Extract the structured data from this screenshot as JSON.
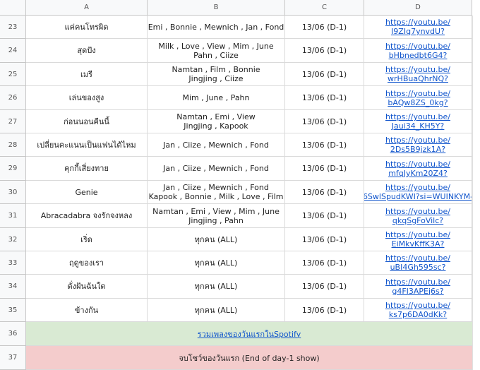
{
  "columns": [
    "A",
    "B",
    "C",
    "D"
  ],
  "rows": [
    {
      "num": "23",
      "song": "แค่คนโทรผิด",
      "members": "Emi , Bonnie , Mewnich , Jan , Fond",
      "date": "13/06 (D-1)",
      "link1": "https://youtu.be/",
      "link2": "I9ZIq7ynvdU?"
    },
    {
      "num": "24",
      "song": "สุดปัง",
      "members": "Milk , Love , View , Mim , June\nPahn , Ciize",
      "date": "13/06 (D-1)",
      "link1": "https://youtu.be/",
      "link2": "bHbnedbt6G4?"
    },
    {
      "num": "25",
      "song": "เมรี",
      "members": "Namtan , Film , Bonnie\nJingjing , Ciize",
      "date": "13/06 (D-1)",
      "link1": "https://youtu.be/",
      "link2": "wrHBuaQhrNQ?"
    },
    {
      "num": "26",
      "song": "เล่นของสูง",
      "members": "Mim , June , Pahn",
      "date": "13/06 (D-1)",
      "link1": "https://youtu.be/",
      "link2": "bAQw8ZS_0kg?"
    },
    {
      "num": "27",
      "song": "ก่อนนอนคืนนี้",
      "members": "Namtan , Emi , View\nJingjing , Kapook",
      "date": "13/06 (D-1)",
      "link1": "https://youtu.be/",
      "link2": "Jaui34_KH5Y?"
    },
    {
      "num": "28",
      "song": "เปลี่ยนคะแนนเป็นแฟนได้ไหม",
      "members": "Jan , Ciize , Mewnich , Fond",
      "date": "13/06 (D-1)",
      "link1": "https://youtu.be/",
      "link2": "2Ds5B9jzk1A?"
    },
    {
      "num": "29",
      "song": "คุกกี้เสี่ยงทาย",
      "members": "Jan , Ciize , Mewnich , Fond",
      "date": "13/06 (D-1)",
      "link1": "https://youtu.be/",
      "link2": "mfqJyKm20Z4?"
    },
    {
      "num": "30",
      "song": "Genie",
      "members": "Jan , Ciize , Mewnich , Fond\nKapook , Bonnie , Milk , Love , Film",
      "date": "13/06 (D-1)",
      "link1": "https://youtu.be/",
      "link2": "6SwlSpudKWI?si=WUINKYM-"
    },
    {
      "num": "31",
      "song": "Abracadabra จงรักจงหลง",
      "members": "Namtan , Emi , View , Mim , June\nJingjing , Pahn",
      "date": "13/06 (D-1)",
      "link1": "https://youtu.be/",
      "link2": "qkqSgFoVilc?"
    },
    {
      "num": "32",
      "song": "เริ่ด",
      "members": "ทุกคน (ALL)",
      "date": "13/06 (D-1)",
      "link1": "https://youtu.be/",
      "link2": "EiMkvKffK3A?"
    },
    {
      "num": "33",
      "song": "ฤดูของเรา",
      "members": "ทุกคน (ALL)",
      "date": "13/06 (D-1)",
      "link1": "https://youtu.be/",
      "link2": "uBI4Gh595sc?"
    },
    {
      "num": "34",
      "song": "ดั่งฝันฉันใด",
      "members": "ทุกคน (ALL)",
      "date": "13/06 (D-1)",
      "link1": "https://youtu.be/",
      "link2": "g4FI3APEj6s?"
    },
    {
      "num": "35",
      "song": "ข้างกัน",
      "members": "ทุกคน (ALL)",
      "date": "13/06 (D-1)",
      "link1": "https://youtu.be/",
      "link2": "ks7p6DA0dKk?"
    }
  ],
  "row36": {
    "num": "36",
    "text": "รวมเพลงของวันแรกในSpotify"
  },
  "row37": {
    "num": "37",
    "text": "จบโชว์ของวันแรก (End of day-1 show)"
  }
}
